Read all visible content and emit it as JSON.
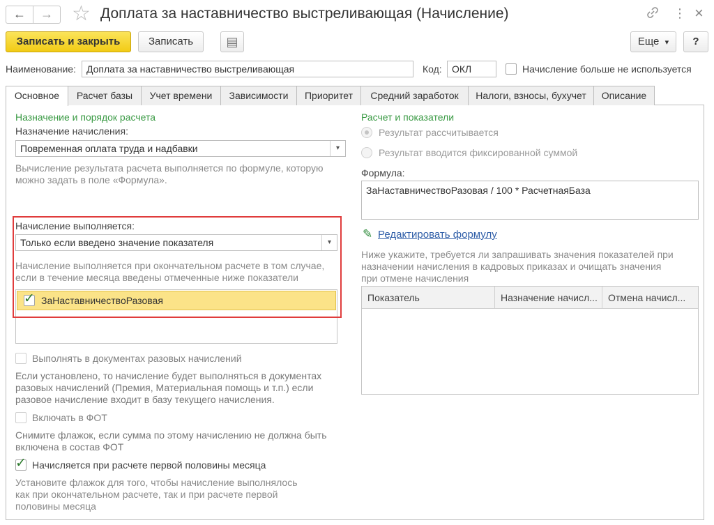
{
  "window": {
    "title": "Доплата за наставничество выстреливающая (Начисление)",
    "nav_back": "←",
    "nav_forward": "→",
    "favorite_glyph": "☆",
    "link_glyph": "🔗",
    "more_glyph": "⋮",
    "close_glyph": "×"
  },
  "toolbar": {
    "save_close": "Записать и закрыть",
    "save": "Записать",
    "report_glyph": "▤",
    "more": "Еще",
    "more_arrow": "▾",
    "help": "?"
  },
  "header": {
    "name_label": "Наименование:",
    "name_value": "Доплата за наставничество выстреливающая",
    "code_label": "Код:",
    "code_value": "ОКЛ",
    "unused_label": "Начисление больше не используется",
    "unused_checked": false
  },
  "tabs": [
    {
      "label": "Основное",
      "active": true
    },
    {
      "label": "Расчет базы",
      "active": false
    },
    {
      "label": "Учет времени",
      "active": false
    },
    {
      "label": "Зависимости",
      "active": false
    },
    {
      "label": "Приоритет",
      "active": false
    },
    {
      "label": "Средний заработок",
      "active": false
    },
    {
      "label": "Налоги, взносы, бухучет",
      "active": false
    },
    {
      "label": "Описание",
      "active": false
    }
  ],
  "left": {
    "section_title": "Назначение и порядок расчета",
    "purpose_label": "Назначение начисления:",
    "purpose_value": "Повременная оплата труда и надбавки",
    "purpose_hint_1": "Вычисление результата расчета выполняется по формуле, которую",
    "purpose_hint_2": "можно задать в поле «Формула».",
    "exec_label": "Начисление выполняется:",
    "exec_value": "Только если введено значение показателя",
    "exec_hint_1": "Начисление выполняется при окончательном расчете в том случае,",
    "exec_hint_2": "если в течение месяца введены отмеченные ниже показатели",
    "indicator_row": "ЗаНаставничествоРазовая",
    "indicator_checked": true,
    "one_time_label": "Выполнять в документах разовых начислений",
    "one_time_hint_1": "Если установлено, то начисление будет выполняться в документах",
    "one_time_hint_2": "разовых начислений (Премия, Материальная помощь и т.п.) если",
    "one_time_hint_3": "разовое начисление входит в базу текущего начисления.",
    "fot_label": "Включать в ФОТ",
    "fot_hint_1": "Снимите флажок, если сумма по этому начислению не должна быть",
    "fot_hint_2": "включена в состав ФОТ",
    "first_half_label": "Начисляется при расчете первой половины месяца",
    "first_half_checked": true,
    "first_half_hint_1": "Установите флажок для того, чтобы начисление выполнялось",
    "first_half_hint_2": "как при окончательном расчете, так и при расчете первой",
    "first_half_hint_3": "половины месяца",
    "select_arrow": "▾",
    "check_glyph": "✓"
  },
  "right": {
    "section_title": "Расчет и показатели",
    "radio_calculated": "Результат рассчитывается",
    "radio_fixed": "Результат вводится фиксированной суммой",
    "formula_label": "Формула:",
    "formula_value": "ЗаНаставничествоРазовая / 100 * РасчетнаяБаза",
    "edit_formula": "Редактировать формулу",
    "pencil_glyph": "✎",
    "hint_1": "Ниже укажите, требуется ли запрашивать значения показателей при",
    "hint_2": "назначении начисления в кадровых приказах и очищать значения",
    "hint_3": "при отмене начисления",
    "table_headers": [
      "Показатель",
      "Назначение начисл...",
      "Отмена начисл..."
    ]
  },
  "colors": {
    "accent_yellow": "#f2cb15",
    "section_green": "#3a9a44",
    "highlight_red": "#e03c3c",
    "link_blue": "#2f5ea8"
  }
}
